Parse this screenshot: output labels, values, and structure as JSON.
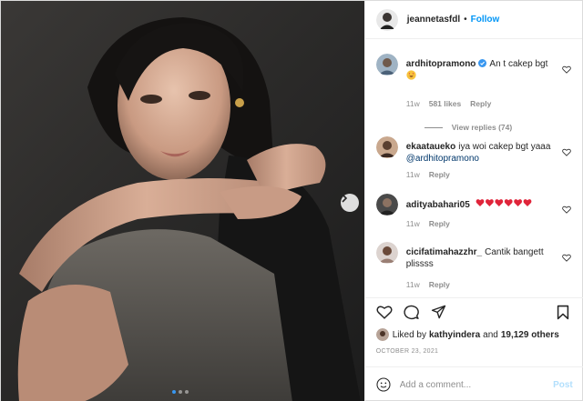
{
  "post": {
    "author": "jeannetasfdl",
    "follow_label": "Follow",
    "carousel": {
      "slides": 3,
      "active_slide": 1
    }
  },
  "comments": [
    {
      "user": "ardhitopramono",
      "verified": true,
      "text": "An  t cakep bgt",
      "emoji": "heart-eyes-emoji",
      "age": "11w",
      "likes": "581 likes",
      "reply": "Reply",
      "view_replies": "View replies (74)"
    },
    {
      "user": "ekaataueko",
      "text": "iya woi cakep bgt yaaa",
      "mention": "@ardhitopramono",
      "age": "11w",
      "reply": "Reply"
    },
    {
      "user": "adityabahari05",
      "text": "",
      "emoji": "red-hearts-x6",
      "age": "11w",
      "reply": "Reply"
    },
    {
      "user": "cicifatimahazzhr_",
      "text": "Cantik bangett",
      "text2": "plissss",
      "age": "11w",
      "reply": "Reply"
    }
  ],
  "likes": {
    "prefix": "Liked by",
    "user": "kathyindera",
    "and": "and",
    "count": "19,129 others"
  },
  "date": "OCTOBER 23, 2021",
  "add_comment": {
    "placeholder": "Add a comment...",
    "post_label": "Post"
  },
  "colors": {
    "link": "#0095f6",
    "heart": "#ed4956",
    "verified": "#3897f0",
    "post_disabled": "#b2dffc"
  }
}
